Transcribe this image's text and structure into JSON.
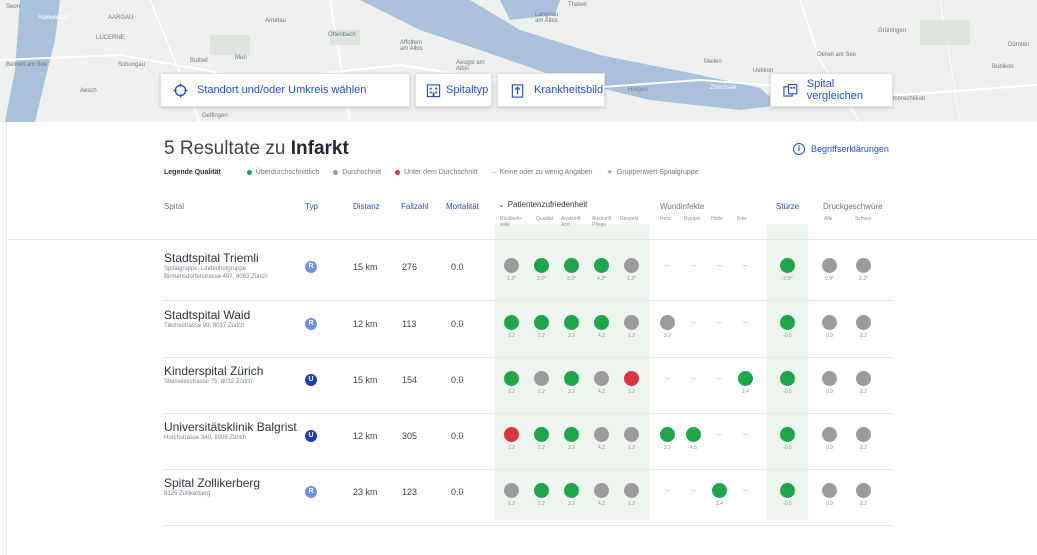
{
  "map": {
    "labels": [
      "Seon",
      "AARGAU",
      "LUCERNE",
      "Hallwilersee",
      "Schongau",
      "Beinwil am See",
      "Aesch",
      "Buttwil",
      "Muri",
      "Arnetau",
      "Ottenbach",
      "Affoltern am Albis",
      "Aeugst am Albis",
      "Langnau am Albis",
      "Thalwil",
      "Horgen",
      "Zürichsee",
      "Meilen",
      "Uetikon",
      "Oetwil am See",
      "Grüningen",
      "Dürnten",
      "Bubikon",
      "Hombrechtikon",
      "Gelfingen"
    ],
    "buttons": {
      "standort": "Standort und/oder Umkreis wählen",
      "spitaltyp": "Spitaltyp",
      "krankheitsbild": "Krankheitsbild",
      "vergleichen": "Spital vergleichen"
    }
  },
  "results": {
    "prefix": "5 Resultate zu ",
    "term": "Infarkt",
    "begriffe": "Begriffserklärungen"
  },
  "legend": {
    "title": "Legende Qualität",
    "items": [
      {
        "label": "Überdurchschnittlich",
        "color": "#1fa64a"
      },
      {
        "label": "Durchschnitt",
        "color": "#9b9b9b"
      },
      {
        "label": "Unter dem Durchschnitt",
        "color": "#d8343b"
      }
    ],
    "dash": "Keine oder zu wenig Angaben",
    "star": "Gruppenwert Spitalgruppe"
  },
  "columns": {
    "spital": "Spital",
    "typ": "Typ",
    "distanz": "Distanz",
    "fallzahl": "Fallzahl",
    "mortalitaet": "Mortalität",
    "patzuf": "Patientenzufriedenheit",
    "patzuf_sub": [
      "Rückkehr-wille",
      "Qualität",
      "Auskunft Arzt",
      "Auskunft Pflege",
      "Respekt"
    ],
    "wundinfekte": "Wundinfekte",
    "wund_sub": [
      "Herz",
      "Bypass",
      "Hüfte",
      "Knie"
    ],
    "stuerze": "Stürze",
    "druck": "Druckgeschwüre",
    "druck_sub": [
      "Alle",
      "Schwer"
    ]
  },
  "hospitals": [
    {
      "name": "Stadtspital Triemli",
      "addr1": "Spitalgruppe: Lindenhofgruppe",
      "addr2": "Birmensdorferstrasse 497, 8063 Zürich",
      "typ": "R",
      "distanz": "15 km",
      "fallzahl": "276",
      "mortalitaet": "0.0",
      "pz": [
        [
          "gr",
          "1.2*"
        ],
        [
          "g",
          "2.2*"
        ],
        [
          "g",
          "3.2*"
        ],
        [
          "g",
          "4.2*"
        ],
        [
          "gr",
          "1.2*"
        ]
      ],
      "wi": [
        [
          "-",
          ""
        ],
        [
          "-",
          ""
        ],
        [
          "-",
          ""
        ],
        [
          "-",
          ""
        ]
      ],
      "st": [
        "g",
        "-0.5*"
      ],
      "dr": [
        [
          "gr",
          "0.9*"
        ],
        [
          "gr",
          "2.2*"
        ]
      ]
    },
    {
      "name": "Stadtspital Waid",
      "addr1": "Tièchestrasse 99, 8037 Zürich",
      "addr2": "",
      "typ": "R",
      "distanz": "12 km",
      "fallzahl": "113",
      "mortalitaet": "0.0",
      "pz": [
        [
          "g",
          "1.2"
        ],
        [
          "g",
          "2.2"
        ],
        [
          "g",
          "3.2"
        ],
        [
          "g",
          "4.2"
        ],
        [
          "gr",
          "1.2"
        ]
      ],
      "wi": [
        [
          "gr",
          "3.2"
        ],
        [
          "-",
          ""
        ],
        [
          "-",
          ""
        ],
        [
          "-",
          ""
        ]
      ],
      "st": [
        "g",
        "-0.5"
      ],
      "dr": [
        [
          "gr",
          "0.9"
        ],
        [
          "gr",
          "2.2"
        ]
      ]
    },
    {
      "name": "Kinderspital Zürich",
      "addr1": "Steinwiesstrasse 75, 8032 Zürich",
      "addr2": "",
      "typ": "U",
      "distanz": "15 km",
      "fallzahl": "154",
      "mortalitaet": "0.0",
      "pz": [
        [
          "g",
          "1.2"
        ],
        [
          "gr",
          "2.2"
        ],
        [
          "g",
          "3.2"
        ],
        [
          "gr",
          "4.2"
        ],
        [
          "r",
          "1.2"
        ]
      ],
      "wi": [
        [
          "-",
          ""
        ],
        [
          "-",
          ""
        ],
        [
          "-",
          ""
        ],
        [
          "g",
          "2.4"
        ]
      ],
      "st": [
        "g",
        "-0.5"
      ],
      "dr": [
        [
          "gr",
          "0.9"
        ],
        [
          "gr",
          "2.2"
        ]
      ]
    },
    {
      "name": "Universitätsklinik Balgrist",
      "addr1": "Horchstrasse 340, 8008 Zürich",
      "addr2": "",
      "typ": "U",
      "distanz": "12 km",
      "fallzahl": "305",
      "mortalitaet": "0.0",
      "pz": [
        [
          "r",
          "1.2"
        ],
        [
          "g",
          "2.2"
        ],
        [
          "g",
          "3.2"
        ],
        [
          "gr",
          "4.2"
        ],
        [
          "gr",
          "1.2"
        ]
      ],
      "wi": [
        [
          "g",
          "3.2"
        ],
        [
          "g",
          "4.5"
        ],
        [
          "-",
          ""
        ],
        [
          "-",
          ""
        ]
      ],
      "st": [
        "g",
        "-0.5"
      ],
      "dr": [
        [
          "gr",
          "0.9"
        ],
        [
          "gr",
          "2.2"
        ]
      ]
    },
    {
      "name": "Spital Zollikerberg",
      "addr1": "8125 Zollikerberg",
      "addr2": "",
      "typ": "R",
      "distanz": "23 km",
      "fallzahl": "123",
      "mortalitaet": "0.0",
      "pz": [
        [
          "gr",
          "1.2"
        ],
        [
          "g",
          "2.2"
        ],
        [
          "g",
          "3.2"
        ],
        [
          "gr",
          "4.2"
        ],
        [
          "gr",
          "1.2"
        ]
      ],
      "wi": [
        [
          "-",
          ""
        ],
        [
          "-",
          ""
        ],
        [
          "g",
          "2.4"
        ],
        [
          "-",
          ""
        ]
      ],
      "st": [
        "g",
        "-0.5"
      ],
      "dr": [
        [
          "gr",
          "0.9"
        ],
        [
          "gr",
          "2.2"
        ]
      ]
    }
  ]
}
